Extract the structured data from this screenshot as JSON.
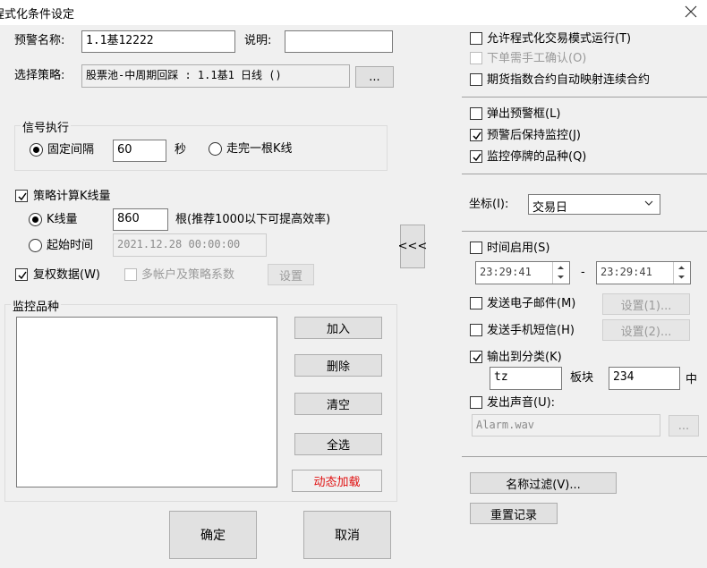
{
  "window": {
    "title": "程式化条件设定",
    "close_icon": "close-icon"
  },
  "left": {
    "alert_name_label": "预警名称:",
    "alert_name_value": "1.1基12222",
    "desc_label": "说明:",
    "desc_value": "",
    "strategy_label": "选择策略:",
    "strategy_value": "股票池-中周期回踩 : 1.1基1 日线 ()",
    "strategy_browse": "...",
    "signal_group": {
      "title": "信号执行",
      "fixed_interval_label": "固定间隔",
      "fixed_interval_value": "60",
      "seconds_unit": "秒",
      "kline_finish_label": "走完一根K线",
      "fixed_interval_selected": true
    },
    "calc_kline_label": "策略计算K线量",
    "calc_kline_checked": true,
    "kline_count_label": "K线量",
    "kline_count_value": "860",
    "kline_hint": "根(推荐1000以下可提高效率)",
    "start_time_label": "起始时间",
    "start_time_value": "2021.12.28 00:00:00",
    "restore_rights_label": "复权数据(W)",
    "restore_rights_checked": true,
    "multi_account_label": "多帐户及策略系数",
    "multi_account_button": "设置",
    "collapse_button": "<<<",
    "monitor_group": {
      "title": "监控品种",
      "add": "加入",
      "delete": "删除",
      "clear": "清空",
      "select_all": "全选",
      "dynamic_load": "动态加载"
    },
    "ok": "确定",
    "cancel": "取消"
  },
  "right": {
    "allow_program_trade": "允许程式化交易模式运行(T)",
    "manual_confirm": "下单需手工确认(O)",
    "futures_map": "期货指数合约自动映射连续合约",
    "popup_alert": "弹出预警框(L)",
    "keep_monitor": "预警后保持监控(J)",
    "monitor_suspended": "监控停牌的品种(Q)",
    "popup_checked": false,
    "keep_monitor_checked": true,
    "monitor_suspended_checked": true,
    "coord_label": "坐标(I):",
    "coord_value": "交易日",
    "time_enable": "时间启用(S)",
    "time_from": "23:29:41",
    "time_dash": "-",
    "time_to": "23:29:41",
    "send_email": "发送电子邮件(M)",
    "email_settings": "设置(1)...",
    "send_sms": "发送手机短信(H)",
    "sms_settings": "设置(2)...",
    "output_category": "输出到分类(K)",
    "output_checked": true,
    "category_value": "tz",
    "block_label": "板块",
    "block_value": "234",
    "block_suffix": "中",
    "play_sound": "发出声音(U):",
    "sound_file": "Alarm.wav",
    "sound_browse": "...",
    "name_filter": "名称过滤(V)...",
    "reset_record": "重置记录"
  }
}
